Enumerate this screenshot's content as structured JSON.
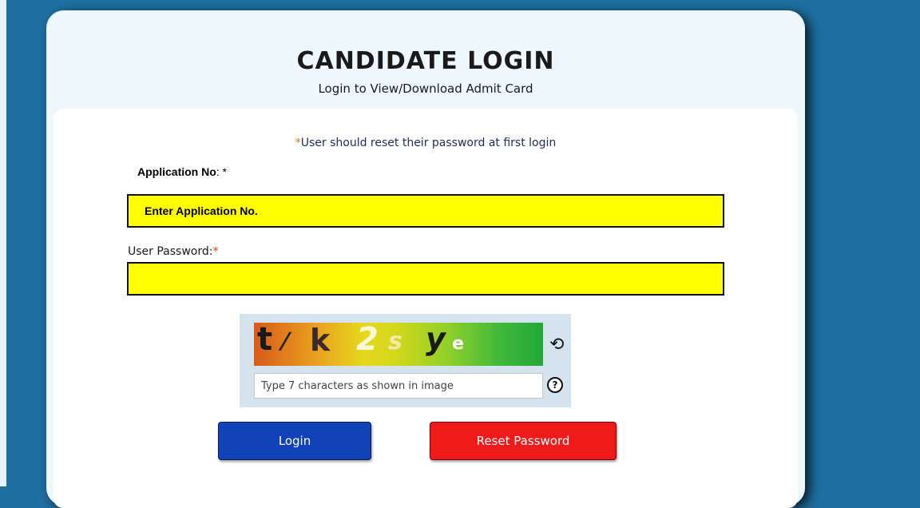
{
  "header": {
    "title": "CANDIDATE LOGIN",
    "subtitle": "Login to View/Download Admit Card"
  },
  "notice": {
    "star": "*",
    "text": "User should reset their password at first login"
  },
  "application_no": {
    "label": "Application No",
    "suffix": ": *",
    "placeholder": "Enter Application No.",
    "value": ""
  },
  "password": {
    "label": "User Password:",
    "required_mark": "*",
    "value": ""
  },
  "captcha": {
    "characters": [
      "t",
      "/",
      "k",
      "2",
      "s",
      "y",
      "e"
    ],
    "input_placeholder": "Type 7 characters as shown in image",
    "refresh_icon": "refresh-icon",
    "help_icon": "help-icon",
    "help_glyph": "?"
  },
  "buttons": {
    "login": "Login",
    "reset_password": "Reset Password"
  },
  "colors": {
    "page_background": "#1f6fa0",
    "field_background": "#ffff00",
    "login_button": "#1142b8",
    "reset_button": "#ef1a1a"
  }
}
